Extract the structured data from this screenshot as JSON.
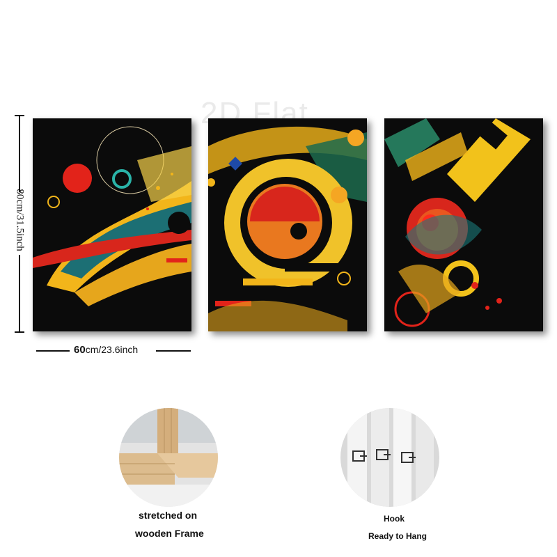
{
  "watermark": "2D Flat",
  "dimensions": {
    "height_label": "80cm/31.5inch",
    "width_number": "60",
    "width_rest": "cm/23.6inch"
  },
  "features": [
    {
      "line1": "stretched on",
      "line2": "wooden Frame"
    },
    {
      "line1": "Hook",
      "line2": "Ready to Hang"
    }
  ],
  "colors": {
    "panel_bg": "#0b0b0b",
    "yellow": "#f5c21b",
    "red": "#e2231a",
    "teal": "#1a7a7a",
    "wood": "#d9b98c"
  }
}
